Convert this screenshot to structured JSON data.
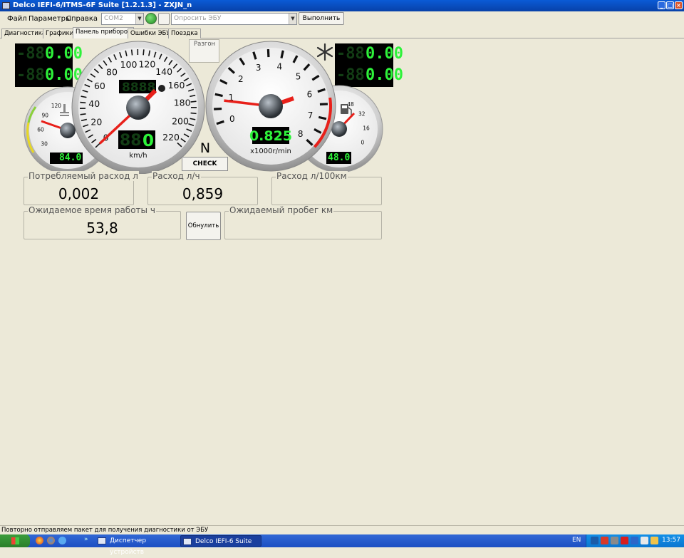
{
  "window": {
    "title": "Delco IEFI-6/ITMS-6F Suite [1.2.1.3] - ZXJN_n"
  },
  "menu": {
    "file": "Файл",
    "params": "Параметры",
    "help": "Справка",
    "port": "COM2",
    "query": "Опросить ЭБУ",
    "execute": "Выполнить"
  },
  "tabs": [
    {
      "label": "Диагностика"
    },
    {
      "label": "Графики"
    },
    {
      "label": "Панель приборов"
    },
    {
      "label": "Ошибки ЭБУ"
    },
    {
      "label": "Поездка"
    }
  ],
  "dash": {
    "top_left_lcd": [
      "0.00",
      "0.00"
    ],
    "top_right_lcd": [
      "0.00",
      "0.00"
    ],
    "speed_value": "0",
    "speed_unit": "km/h",
    "speed_scale": [
      "0",
      "20",
      "40",
      "60",
      "80",
      "100",
      "120",
      "140",
      "160",
      "180",
      "200",
      "220"
    ],
    "speed_needle": 0,
    "odometer": "",
    "rpm_value": "0.825",
    "rpm_unit": "x1000r/min",
    "rpm_scale": [
      "0",
      "1",
      "2",
      "3",
      "4",
      "5",
      "6",
      "7",
      "8"
    ],
    "rpm_needle": 0.825,
    "coolant_scale": [
      "30",
      "60",
      "90",
      "120"
    ],
    "coolant_lcd": "84.0",
    "fuel_scale": [
      "0",
      "16",
      "32",
      "48"
    ],
    "fuel_lcd": "48.0",
    "gear": "N",
    "check": "CHECK",
    "razgon": "Разгон",
    "snowflake": "snowflake-icon"
  },
  "groups": {
    "consumption_label": "Потребляемый расход л",
    "consumption_value": "0,002",
    "rate_label": "Расход л/ч",
    "rate_value": "0,859",
    "per100_label": "Расход л/100км",
    "worktime_label": "Ожидаемое время работы ч",
    "worktime_value": "53,8",
    "reset_button": "Обнулить",
    "mileage_label": "Ожидаемый пробег км"
  },
  "status": {
    "text": "Повторно отправляем пакет для получения диагностики от ЭБУ"
  },
  "taskbar": {
    "task1": "Диспетчер устройств",
    "task2": "Delco IEFI-6 Suite",
    "lang": "EN",
    "clock": "13:57"
  },
  "colors": {
    "lcd_green": "#2ef23a",
    "needle_red": "#e8201a",
    "title_blue": "#0a5bd6"
  }
}
